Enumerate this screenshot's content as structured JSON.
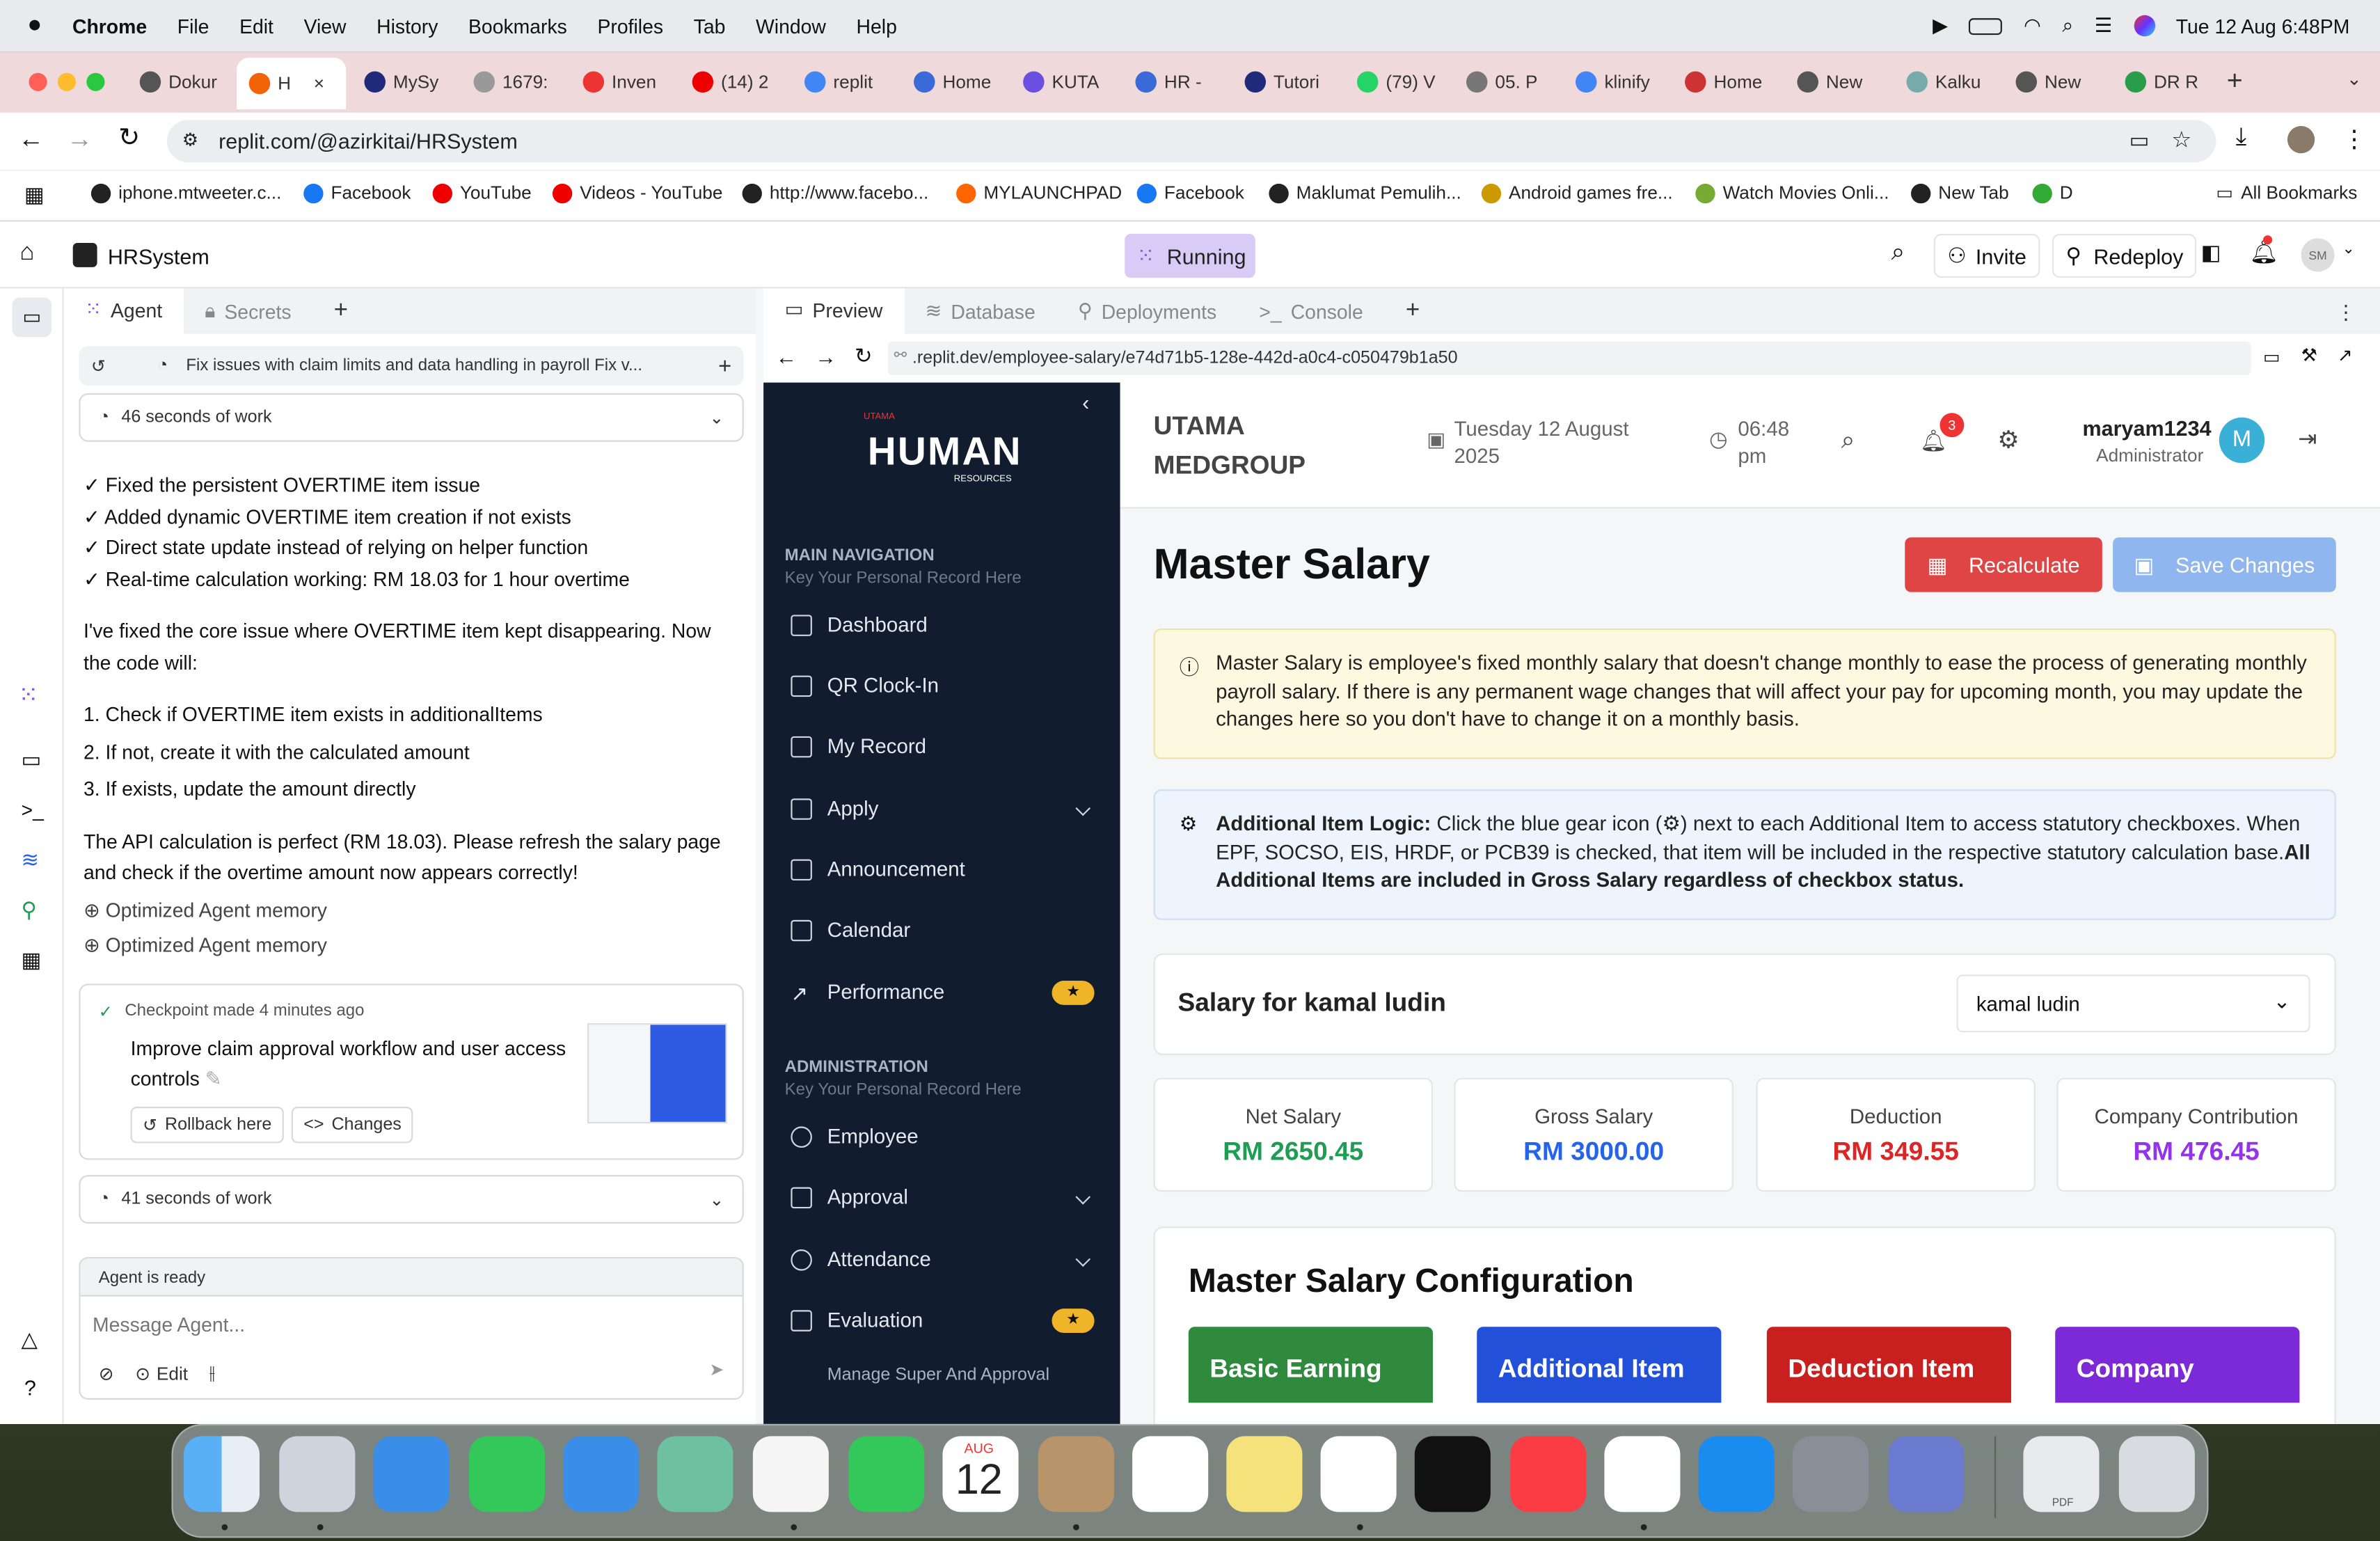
{
  "menubar": {
    "app": "Chrome",
    "items": [
      "File",
      "Edit",
      "View",
      "History",
      "Bookmarks",
      "Profiles",
      "Tab",
      "Window",
      "Help"
    ],
    "datetime": "Tue 12 Aug  6:48PM"
  },
  "tabs": [
    {
      "label": "Dokur",
      "color": "#555"
    },
    {
      "label": "H",
      "color": "#f26207",
      "active": true
    },
    {
      "label": "MySy",
      "color": "#1f2a7a"
    },
    {
      "label": "1679:",
      "color": "#999"
    },
    {
      "label": "Inven",
      "color": "#e33"
    },
    {
      "label": "(14) 2",
      "color": "#e00"
    },
    {
      "label": "replit",
      "color": "#4285f4"
    },
    {
      "label": "Home",
      "color": "#3a6ad8"
    },
    {
      "label": "KUTA",
      "color": "#6a4fe0"
    },
    {
      "label": "HR -",
      "color": "#3a6ad8"
    },
    {
      "label": "Tutori",
      "color": "#1f2a7a"
    },
    {
      "label": "(79) V",
      "color": "#25d366"
    },
    {
      "label": "05. P",
      "color": "#777"
    },
    {
      "label": "klinify",
      "color": "#4285f4"
    },
    {
      "label": "Home",
      "color": "#c33"
    },
    {
      "label": "New",
      "color": "#555"
    },
    {
      "label": "Kalku",
      "color": "#7aa"
    },
    {
      "label": "New",
      "color": "#555"
    },
    {
      "label": "DR R",
      "color": "#2a9d4a"
    }
  ],
  "address": {
    "url": "replit.com/@azirkitai/HRSystem"
  },
  "bookmarks": [
    {
      "label": "iphone.mtweeter.c...",
      "color": "#222"
    },
    {
      "label": "Facebook",
      "color": "#1877f2"
    },
    {
      "label": "YouTube",
      "color": "#e00"
    },
    {
      "label": "Videos - YouTube",
      "color": "#e00"
    },
    {
      "label": "http://www.facebo...",
      "color": "#222"
    },
    {
      "label": "MYLAUNCHPAD",
      "color": "#f60"
    },
    {
      "label": "Facebook",
      "color": "#1877f2"
    },
    {
      "label": "Maklumat Pemulih...",
      "color": "#222"
    },
    {
      "label": "Android games fre...",
      "color": "#c90"
    },
    {
      "label": "Watch Movies Onli...",
      "color": "#7a3"
    },
    {
      "label": "New Tab",
      "color": "#222"
    },
    {
      "label": "D",
      "color": "#3a3"
    }
  ],
  "bookmarks_all": "All Bookmarks",
  "replit": {
    "project": "HRSystem",
    "status": "Running",
    "invite": "Invite",
    "redeploy": "Redeploy",
    "avatar": "SM",
    "pane_tabs": {
      "agent": "Agent",
      "secrets": "Secrets"
    },
    "right_tabs": {
      "preview": "Preview",
      "database": "Database",
      "deployments": "Deployments",
      "console": "Console"
    }
  },
  "agent": {
    "thread_title": "Fix issues with claim limits and data handling in payroll Fix v...",
    "work1": "46 seconds of work",
    "checks": [
      "✓ Fixed the persistent OVERTIME item issue",
      "✓ Added dynamic OVERTIME item creation if not exists",
      "✓ Direct state update instead of relying on helper function",
      "✓ Real-time calculation working: RM 18.03 for 1 hour overtime"
    ],
    "para1": "I've fixed the core issue where OVERTIME item kept disappearing. Now the code will:",
    "steps": [
      "1. Check if OVERTIME item exists in additionalItems",
      "2. If not, create it with the calculated amount",
      "3. If exists, update the amount directly"
    ],
    "para2": "The API calculation is perfect (RM 18.03). Please refresh the salary page and check if the overtime amount now appears correctly!",
    "memory": [
      "Optimized Agent memory",
      "Optimized Agent memory"
    ],
    "checkpoint_time": "Checkpoint made 4 minutes ago",
    "checkpoint_desc": "Improve claim approval workflow and user access controls",
    "rollback": "Rollback here",
    "changes": "Changes",
    "work2": "41 seconds of work",
    "ready": "Agent is ready",
    "placeholder": "Message Agent...",
    "edit": "Edit"
  },
  "preview_url": ".replit.dev/employee-salary/e74d71b5-128e-442d-a0c4-c050479b1a50",
  "hr": {
    "logo_small": "UTAMA",
    "logo": "HUMAN",
    "logo_sub": "RESOURCES",
    "main_nav": "MAIN NAVIGATION",
    "main_nav_sub": "Key Your Personal Record Here",
    "nav": [
      "Dashboard",
      "QR Clock-In",
      "My Record",
      "Apply",
      "Announcement",
      "Calendar",
      "Performance"
    ],
    "admin": "ADMINISTRATION",
    "admin_sub": "Key Your Personal Record Here",
    "admin_nav": [
      "Employee",
      "Approval",
      "Attendance",
      "Evaluation"
    ],
    "footer": "Manage Super And Approval",
    "company": "UTAMA MEDGROUP",
    "date": "Tuesday 12 August 2025",
    "time": "06:48 pm",
    "notif": "3",
    "user": "maryam1234",
    "role": "Administrator",
    "user_initial": "M",
    "title": "Master Salary",
    "recalc": "Recalculate",
    "save": "Save Changes",
    "info": "Master Salary is employee's fixed monthly salary that doesn't change monthly to ease the process of generating monthly payroll salary. If there is any permanent wage changes that will affect your pay for upcoming month, you may update the changes here so you don't have to change it on a monthly basis.",
    "logic_label": "Additional Item Logic:",
    "logic_text": " Click the blue gear icon (⚙) next to each Additional Item to access statutory checkboxes. When EPF, SOCSO, EIS, HRDF, or PCB39 is checked, that item will be included in the respective statutory calculation base.",
    "logic_bold": "All Additional Items are included in Gross Salary regardless of checkbox status.",
    "salary_for": "Salary for kamal ludin",
    "employee": "kamal ludin",
    "stats": [
      {
        "label": "Net Salary",
        "value": "RM 2650.45",
        "color": "#1f9d55"
      },
      {
        "label": "Gross Salary",
        "value": "RM 3000.00",
        "color": "#2563eb"
      },
      {
        "label": "Deduction",
        "value": "RM 349.55",
        "color": "#dc2626"
      },
      {
        "label": "Company Contribution",
        "value": "RM 476.45",
        "color": "#9333ea"
      }
    ],
    "config_title": "Master Salary Configuration",
    "config_tabs": [
      {
        "label": "Basic Earning",
        "color": "#2f8a3e"
      },
      {
        "label": "Additional Item",
        "color": "#2350d8"
      },
      {
        "label": "Deduction Item",
        "color": "#c8201f"
      },
      {
        "label": "Company",
        "color": "#7c2ad8"
      }
    ]
  },
  "dock": {
    "calendar_month": "AUG",
    "calendar_day": "12",
    "pdf": "PDF",
    "apps": [
      "finder",
      "launchpad",
      "safari",
      "messages",
      "mail",
      "maps",
      "photos",
      "facetime",
      "calendar",
      "contacts",
      "reminders",
      "notes",
      "freeform",
      "tv",
      "music",
      "chrome",
      "appstore",
      "settings",
      "iphone-mirroring",
      "downloads",
      "trash"
    ]
  }
}
